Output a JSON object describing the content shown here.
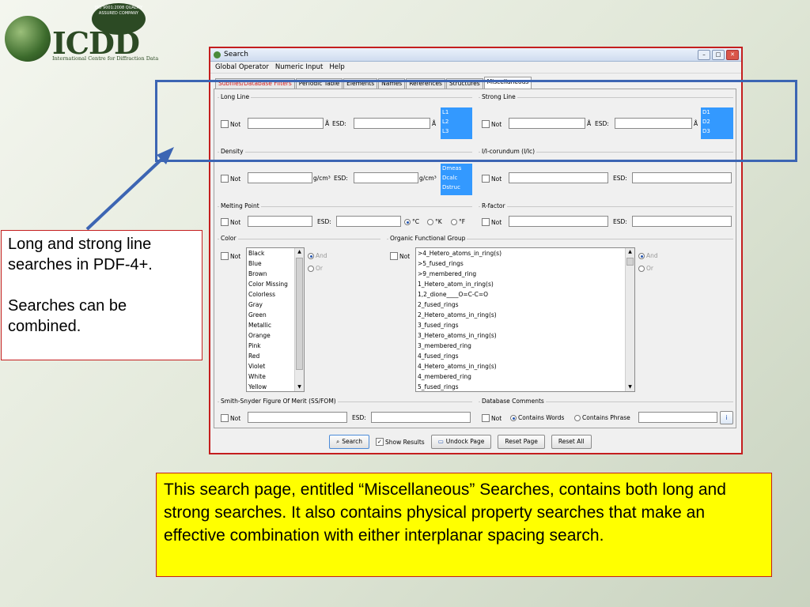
{
  "logo": {
    "brand": "ICDD",
    "tagline": "International Centre for Diffraction Data",
    "badge": "ISO 9001:2008 QUALITY ASSURED COMPANY"
  },
  "window": {
    "title": "Search",
    "menu": [
      "Global Operator",
      "Numeric Input",
      "Help"
    ],
    "tabs": [
      "Subfiles/Database Filters",
      "Periodic Table",
      "Elements",
      "Names",
      "References",
      "Structures",
      "Miscellaneous"
    ],
    "not": "Not",
    "esd": "ESD:",
    "angstrom": "Å",
    "gcm": "g/cm³",
    "long_line": {
      "title": "Long Line",
      "list": [
        "L1",
        "L2",
        "L3"
      ]
    },
    "strong_line": {
      "title": "Strong Line",
      "list": [
        "D1",
        "D2",
        "D3"
      ]
    },
    "density": {
      "title": "Density",
      "list": [
        "Dmeas",
        "Dcalc",
        "Dstruc"
      ]
    },
    "icorundum": {
      "title": "I/I-corundum (I/Ic)"
    },
    "melting": {
      "title": "Melting Point",
      "units": [
        "°C",
        "°K",
        "°F"
      ]
    },
    "rfactor": {
      "title": "R-factor"
    },
    "color": {
      "title": "Color",
      "items": [
        "Black",
        "Blue",
        "Brown",
        "Color Missing",
        "Colorless",
        "Gray",
        "Green",
        "Metallic",
        "Orange",
        "Pink",
        "Red",
        "Violet",
        "White",
        "Yellow"
      ],
      "and": "And",
      "or": "Or"
    },
    "organic": {
      "title": "Organic Functional Group",
      "items": [
        ">4_Hetero_atoms_in_ring(s)",
        ">5_fused_rings",
        ">9_membered_ring",
        "1_Hetero_atom_in_ring(s)",
        "1,2_dione____O=C-C=O",
        "2_fused_rings",
        "2_Hetero_atoms_in_ring(s)",
        "3_fused_rings",
        "3_Hetero_atoms_in_ring(s)",
        "3_membered_ring",
        "4_fused_rings",
        "4_Hetero_atoms_in_ring(s)",
        "4_membered_ring",
        "5_fused_rings"
      ],
      "and": "And",
      "or": "Or"
    },
    "ssfom": {
      "title": "Smith-Snyder Figure Of Merit (SS/FOM)"
    },
    "dbcomments": {
      "title": "Database Comments",
      "contains_words": "Contains Words",
      "contains_phrase": "Contains Phrase"
    },
    "buttons": {
      "search": "Search",
      "show_results": "Show Results",
      "undock": "Undock Page",
      "reset_page": "Reset Page",
      "reset_all": "Reset All"
    }
  },
  "notes": {
    "left_line1": "Long and strong line searches in PDF-4+.",
    "left_line2": "Searches can be combined.",
    "bottom": "This search page, entitled “Miscellaneous” Searches, contains both long and strong searches. It also contains physical property searches that make an effective combination with either interplanar spacing search."
  }
}
